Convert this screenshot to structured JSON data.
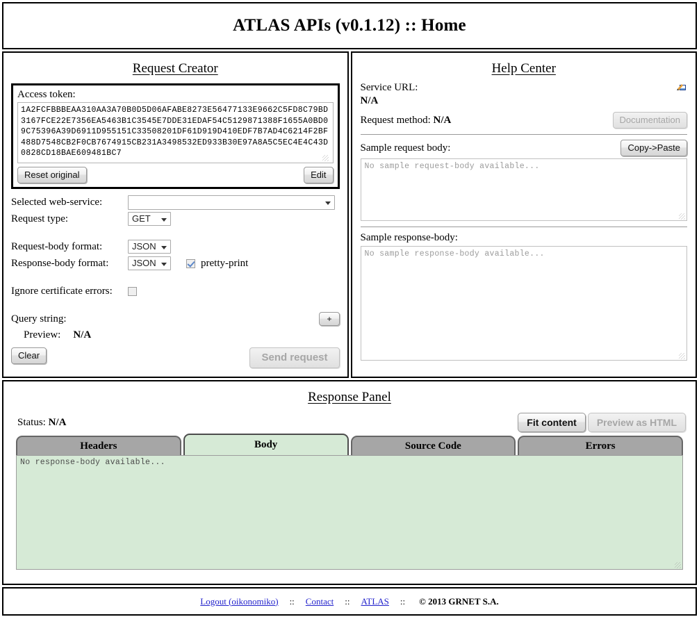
{
  "header": {
    "title": "ATLAS APIs (v0.1.12) :: Home"
  },
  "request_creator": {
    "title": "Request Creator",
    "access_token_label": "Access token:",
    "access_token_value": "1A2FCFBBBEAA310AA3A70B0D5D06AFABE8273E56477133E9662C5FD8C79BD3167FCE22E7356EA5463B1C3545E7DDE31EDAF54C5129871388F1655A0BD09C75396A39D6911D955151C33508201DF61D919D410EDF7B7AD4C6214F2BF488D7548CB2F0CB7674915CB231A3498532ED933B30E97A8A5C5EC4E4C43D0828CD18BAE609481BC7",
    "reset_label": "Reset original",
    "edit_label": "Edit",
    "selected_webservice_label": "Selected web-service:",
    "selected_webservice_value": "",
    "request_type_label": "Request type:",
    "request_type_value": "GET",
    "request_body_format_label": "Request-body format:",
    "request_body_format_value": "JSON",
    "response_body_format_label": "Response-body format:",
    "response_body_format_value": "JSON",
    "pretty_print_label": "pretty-print",
    "pretty_print_checked": true,
    "ignore_cert_label": "Ignore certificate errors:",
    "ignore_cert_checked": false,
    "query_string_label": "Query string:",
    "add_param_label": "+",
    "preview_label": "Preview:",
    "preview_value": "N/A",
    "clear_label": "Clear",
    "send_request_label": "Send request"
  },
  "help_center": {
    "title": "Help Center",
    "service_url_label": "Service URL:",
    "service_url_value": "N/A",
    "request_method_label": "Request method:",
    "request_method_value": "N/A",
    "documentation_label": "Documentation",
    "sample_request_label": "Sample request body:",
    "copy_paste_label": "Copy->Paste",
    "sample_request_placeholder": "No sample request-body available...",
    "sample_response_label": "Sample response-body:",
    "sample_response_placeholder": "No sample response-body available..."
  },
  "response_panel": {
    "title": "Response Panel",
    "status_label": "Status:",
    "status_value": "N/A",
    "fit_content_label": "Fit content",
    "preview_html_label": "Preview as HTML",
    "tabs": [
      {
        "label": "Headers",
        "active": false
      },
      {
        "label": "Body",
        "active": true
      },
      {
        "label": "Source Code",
        "active": false
      },
      {
        "label": "Errors",
        "active": false
      }
    ],
    "body_placeholder": "No response-body available..."
  },
  "footer": {
    "logout": "Logout (oikonomiko)",
    "sep": "::",
    "contact": "Contact",
    "atlas": "ATLAS",
    "copyright": "© 2013 GRNET S.A."
  },
  "colors": {
    "accent_green": "#d6ead6",
    "tab_inactive": "#a6a6a6",
    "link_blue": "#2222cc"
  }
}
